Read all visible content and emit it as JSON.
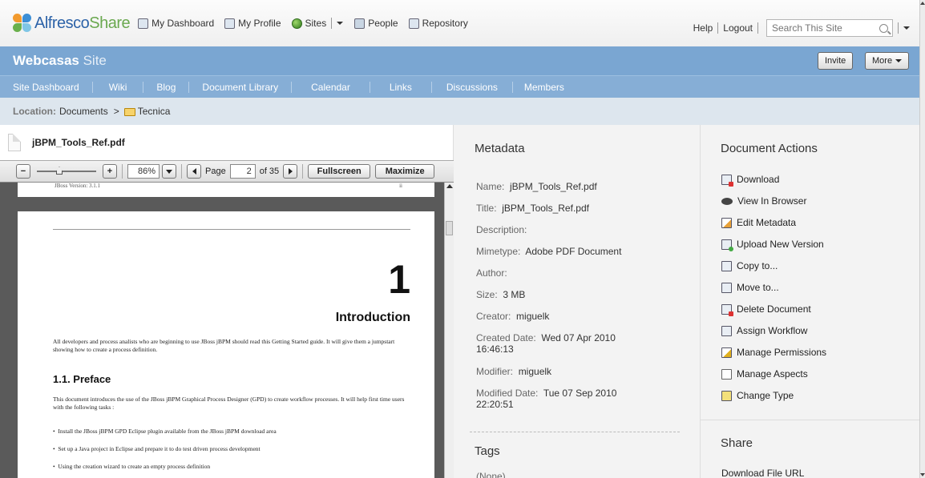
{
  "app": {
    "logo_primary": "Alfresco",
    "logo_secondary": "Share",
    "accent_blue": "#7aa6d2",
    "accent_green": "#6aa84f"
  },
  "topnav": {
    "items": [
      {
        "label": "My Dashboard",
        "icon": "dashboard-icon"
      },
      {
        "label": "My Profile",
        "icon": "profile-icon"
      },
      {
        "label": "Sites",
        "icon": "globe-icon"
      },
      {
        "label": "People",
        "icon": "people-icon"
      },
      {
        "label": "Repository",
        "icon": "repository-icon"
      }
    ],
    "help": "Help",
    "logout": "Logout",
    "search_placeholder": "Search This Site"
  },
  "site": {
    "name": "Webcasas",
    "suffix": "Site",
    "invite_label": "Invite",
    "more_label": "More"
  },
  "sitenav": {
    "tabs": [
      "Site Dashboard",
      "Wiki",
      "Blog",
      "Document Library",
      "Calendar",
      "Links",
      "Discussions",
      "Members"
    ]
  },
  "location": {
    "label": "Location:",
    "root": "Documents",
    "separator": ">",
    "folder": "Tecnica"
  },
  "viewer": {
    "filename": "jBPM_Tools_Ref.pdf",
    "zoom": "86%",
    "page_label": "Page",
    "page_current": "2",
    "page_of": "of 35",
    "fullscreen_label": "Fullscreen",
    "maximize_label": "Maximize",
    "prev_page_header": "JBoss Version: 3.1.1",
    "prev_page_number": "ii",
    "chapter_number": "1",
    "chapter_title": "Introduction",
    "intro_para": "All developers and process analists who are beginning to use JBoss jBPM should read this Getting Started guide. It will give them a jumpstart showing how to create a process definition.",
    "section_title": "1.1. Preface",
    "preface_para": "This document introduces the use of the JBoss jBPM Graphical Process Designer (GPD) to create workflow processes. It will help first time users with the following tasks :",
    "bullets": [
      "Install the JBoss jBPM GPD Eclipse plugin available from the JBoss jBPM download area",
      "Set up a Java project in Eclipse and prepare it to do test driven process development",
      "Using the creation wizard to create an empty process definition"
    ]
  },
  "metadata": {
    "title": "Metadata",
    "fields": [
      {
        "label": "Name:",
        "value": "jBPM_Tools_Ref.pdf"
      },
      {
        "label": "Title:",
        "value": "jBPM_Tools_Ref.pdf"
      },
      {
        "label": "Description:",
        "value": ""
      },
      {
        "label": "Mimetype:",
        "value": "Adobe PDF Document"
      },
      {
        "label": "Author:",
        "value": ""
      },
      {
        "label": "Size:",
        "value": "3 MB"
      },
      {
        "label": "Creator:",
        "value": "miguelk"
      },
      {
        "label": "Created Date:",
        "value": "Wed 07 Apr 2010 16:46:13"
      },
      {
        "label": "Modifier:",
        "value": "miguelk"
      },
      {
        "label": "Modified Date:",
        "value": "Tue 07 Sep 2010 22:20:51"
      }
    ],
    "tags_title": "Tags",
    "tags_value": "(None)"
  },
  "actions": {
    "title": "Document Actions",
    "items": [
      {
        "label": "Download",
        "icon": "download-icon"
      },
      {
        "label": "View In Browser",
        "icon": "binoculars-icon"
      },
      {
        "label": "Edit Metadata",
        "icon": "edit-metadata-icon"
      },
      {
        "label": "Upload New Version",
        "icon": "upload-icon"
      },
      {
        "label": "Copy to...",
        "icon": "copy-icon"
      },
      {
        "label": "Move to...",
        "icon": "move-icon"
      },
      {
        "label": "Delete Document",
        "icon": "delete-icon"
      },
      {
        "label": "Assign Workflow",
        "icon": "workflow-icon"
      },
      {
        "label": "Manage Permissions",
        "icon": "permissions-icon"
      },
      {
        "label": "Manage Aspects",
        "icon": "aspects-icon"
      },
      {
        "label": "Change Type",
        "icon": "change-type-icon"
      }
    ],
    "share_title": "Share",
    "share_download_url": "Download File URL"
  }
}
